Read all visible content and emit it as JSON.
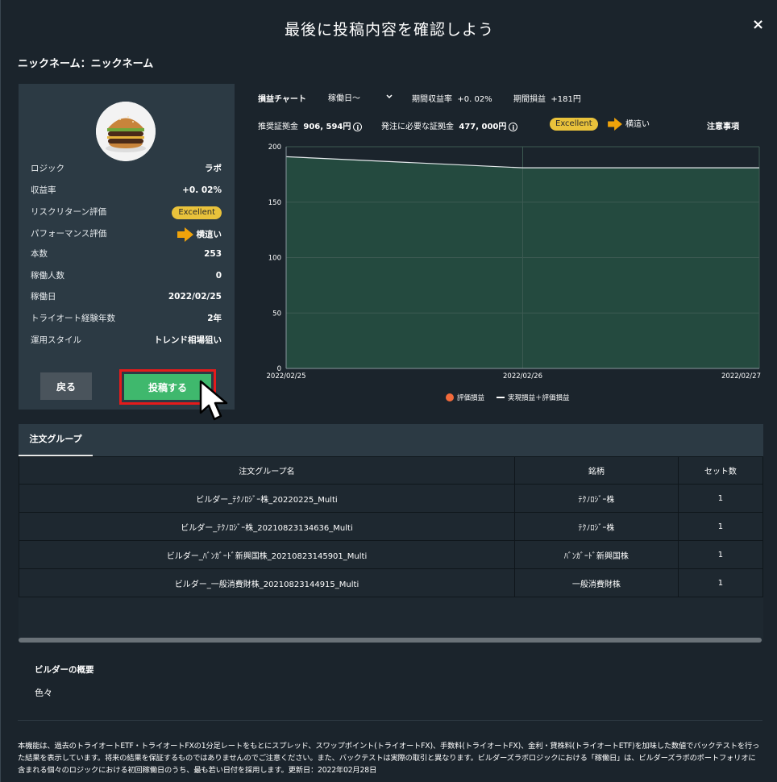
{
  "modal": {
    "title": "最後に投稿内容を確認しよう",
    "close_glyph": "×",
    "nickname_label": "ニックネーム：ニックネーム"
  },
  "profile": {
    "rows": [
      {
        "label": "ロジック",
        "value": "ラボ"
      },
      {
        "label": "収益率",
        "value": "+0. 02%"
      },
      {
        "label": "リスクリターン評価",
        "value": "Excellent"
      },
      {
        "label": "パフォーマンス評価",
        "value": "横這い"
      },
      {
        "label": "本数",
        "value": "253"
      },
      {
        "label": "稼働人数",
        "value": "0"
      },
      {
        "label": "稼働日",
        "value": "2022/02/25"
      },
      {
        "label": "トライオート経験年数",
        "value": "2年"
      },
      {
        "label": "運用スタイル",
        "value": "トレンド相場狙い"
      }
    ],
    "back_label": "戻る",
    "post_label": "投稿する"
  },
  "chart_header": {
    "title": "損益チャート",
    "period_select": "稼働日〜",
    "period_return_label": "期間収益率",
    "period_return_value": "+0. 02%",
    "period_pl_label": "期間損益",
    "period_pl_value": "+181円",
    "recommended_margin_label": "推奨証拠金",
    "recommended_margin_value": "906, 594円",
    "required_margin_label": "発注に必要な証拠金",
    "required_margin_value": "477, 000円",
    "risk_badge": "Excellent",
    "performance": "横這い",
    "notes_link": "注意事項"
  },
  "chart_data": {
    "type": "area",
    "x": [
      "2022/02/25",
      "2022/02/26",
      "2022/02/27"
    ],
    "series": [
      {
        "name": "実現損益＋評価損益",
        "values": [
          191,
          181,
          181
        ]
      }
    ],
    "ylim": [
      0,
      200
    ],
    "yticks": [
      "0",
      "50",
      "100",
      "150",
      "200"
    ],
    "legend": [
      "評価損益",
      "実現損益＋評価損益"
    ],
    "legend_position": "bottom",
    "colors": {
      "area": "#244a3f",
      "line": "#e8ecef",
      "legend_dot": "#f26a3b",
      "grid": "#3c5a52"
    }
  },
  "groups": {
    "tab_label": "注文グループ",
    "headers": [
      "注文グループ名",
      "銘柄",
      "セット数"
    ],
    "rows": [
      [
        "ビルダー_ﾃｸﾉﾛｼﾞｰ株_20220225_Multi",
        "ﾃｸﾉﾛｼﾞｰ株",
        "1"
      ],
      [
        "ビルダー_ﾃｸﾉﾛｼﾞｰ株_20210823134636_Multi",
        "ﾃｸﾉﾛｼﾞｰ株",
        "1"
      ],
      [
        "ビルダー_ﾊﾞﾝｶﾞｰﾄﾞ新興国株_20210823145901_Multi",
        "ﾊﾞﾝｶﾞｰﾄﾞ新興国株",
        "1"
      ],
      [
        "ビルダー_一般消費財株_20210823144915_Multi",
        "一般消費財株",
        "1"
      ]
    ]
  },
  "overview": {
    "title": "ビルダーの概要",
    "text": "色々"
  },
  "disclaimer": "本機能は、過去のトライオートETF・トライオートFXの1分足レートをもとにスプレッド、スワップポイント(トライオートFX)、手数料(トライオートFX)、金利・貸株料(トライオートETF)を加味した数値でバックテストを行った結果を表示しています。将来の結果を保証するものではありませんのでご注意ください。また、バックテストは実際の取引と異なります。ビルダーズラボロジックにおける「稼働日」は、ビルダーズラボのポートフォリオに含まれる個々のロジックにおける初回稼働日のうち、最も若い日付を採用します。更新日：2022年02月28日"
}
